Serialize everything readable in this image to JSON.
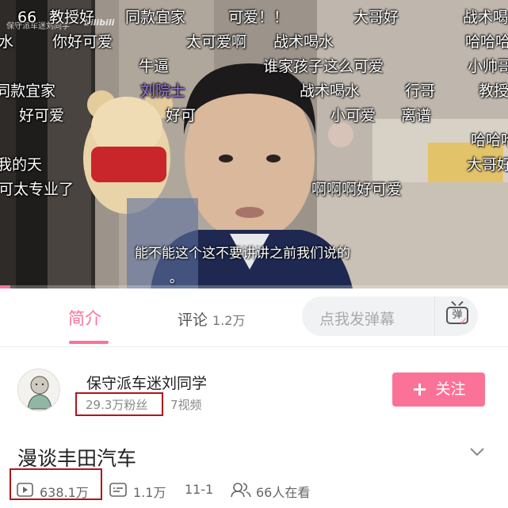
{
  "video": {
    "danmaku": [
      {
        "text": "66",
        "hl": false
      },
      {
        "text": "教授好",
        "hl": false
      },
      {
        "text": "同款宜家",
        "hl": false
      },
      {
        "text": "可爱！！",
        "hl": false
      },
      {
        "text": "大哥好",
        "hl": false
      },
      {
        "text": "战术喝",
        "hl": false
      },
      {
        "text": "水",
        "hl": false
      },
      {
        "text": "你好可爱",
        "hl": false
      },
      {
        "text": "太可爱啊",
        "hl": false
      },
      {
        "text": "战术喝水",
        "hl": false
      },
      {
        "text": "哈哈哈",
        "hl": false
      },
      {
        "text": "牛逼",
        "hl": false
      },
      {
        "text": "谁家孩子这么可爱",
        "hl": false
      },
      {
        "text": "小帅哥",
        "hl": false
      },
      {
        "text": "同款宜家",
        "hl": false
      },
      {
        "text": "刘院士",
        "hl": true
      },
      {
        "text": "战术喝水",
        "hl": false
      },
      {
        "text": "行哥",
        "hl": false
      },
      {
        "text": "教授",
        "hl": false
      },
      {
        "text": "好可爱",
        "hl": false
      },
      {
        "text": "好可",
        "hl": false
      },
      {
        "text": "小可爱",
        "hl": false
      },
      {
        "text": "离谱",
        "hl": false
      },
      {
        "text": "哈哈哈",
        "hl": false
      },
      {
        "text": "我的天",
        "hl": false
      },
      {
        "text": "大哥好",
        "hl": false
      },
      {
        "text": "可太专业了",
        "hl": false
      },
      {
        "text": "啊啊啊好可爱",
        "hl": false
      }
    ],
    "watermark": "保守派车迷刘同学",
    "logo": "bilibili",
    "subtitle": "能不能这个这不要讲讲之前我们说的",
    "subtitle_tail": "。",
    "progress": 0.02
  },
  "tabs": {
    "intro": "简介",
    "comments_label": "评论",
    "comments_count": "1.2万",
    "danmaku_placeholder": "点我发弹幕",
    "danmaku_button": "弹"
  },
  "uploader": {
    "name": "保守派车迷刘同学",
    "fans": "29.3万粉丝",
    "videos": "7视频",
    "follow_label": "关注"
  },
  "video_info": {
    "title": "漫谈丰田汽车",
    "views": "638.1万",
    "danmaku_count": "1.1万",
    "date": "11-1",
    "watching": "66人在看"
  },
  "colors": {
    "accent": "#fb7299",
    "highlight_box": "#b3141b"
  }
}
